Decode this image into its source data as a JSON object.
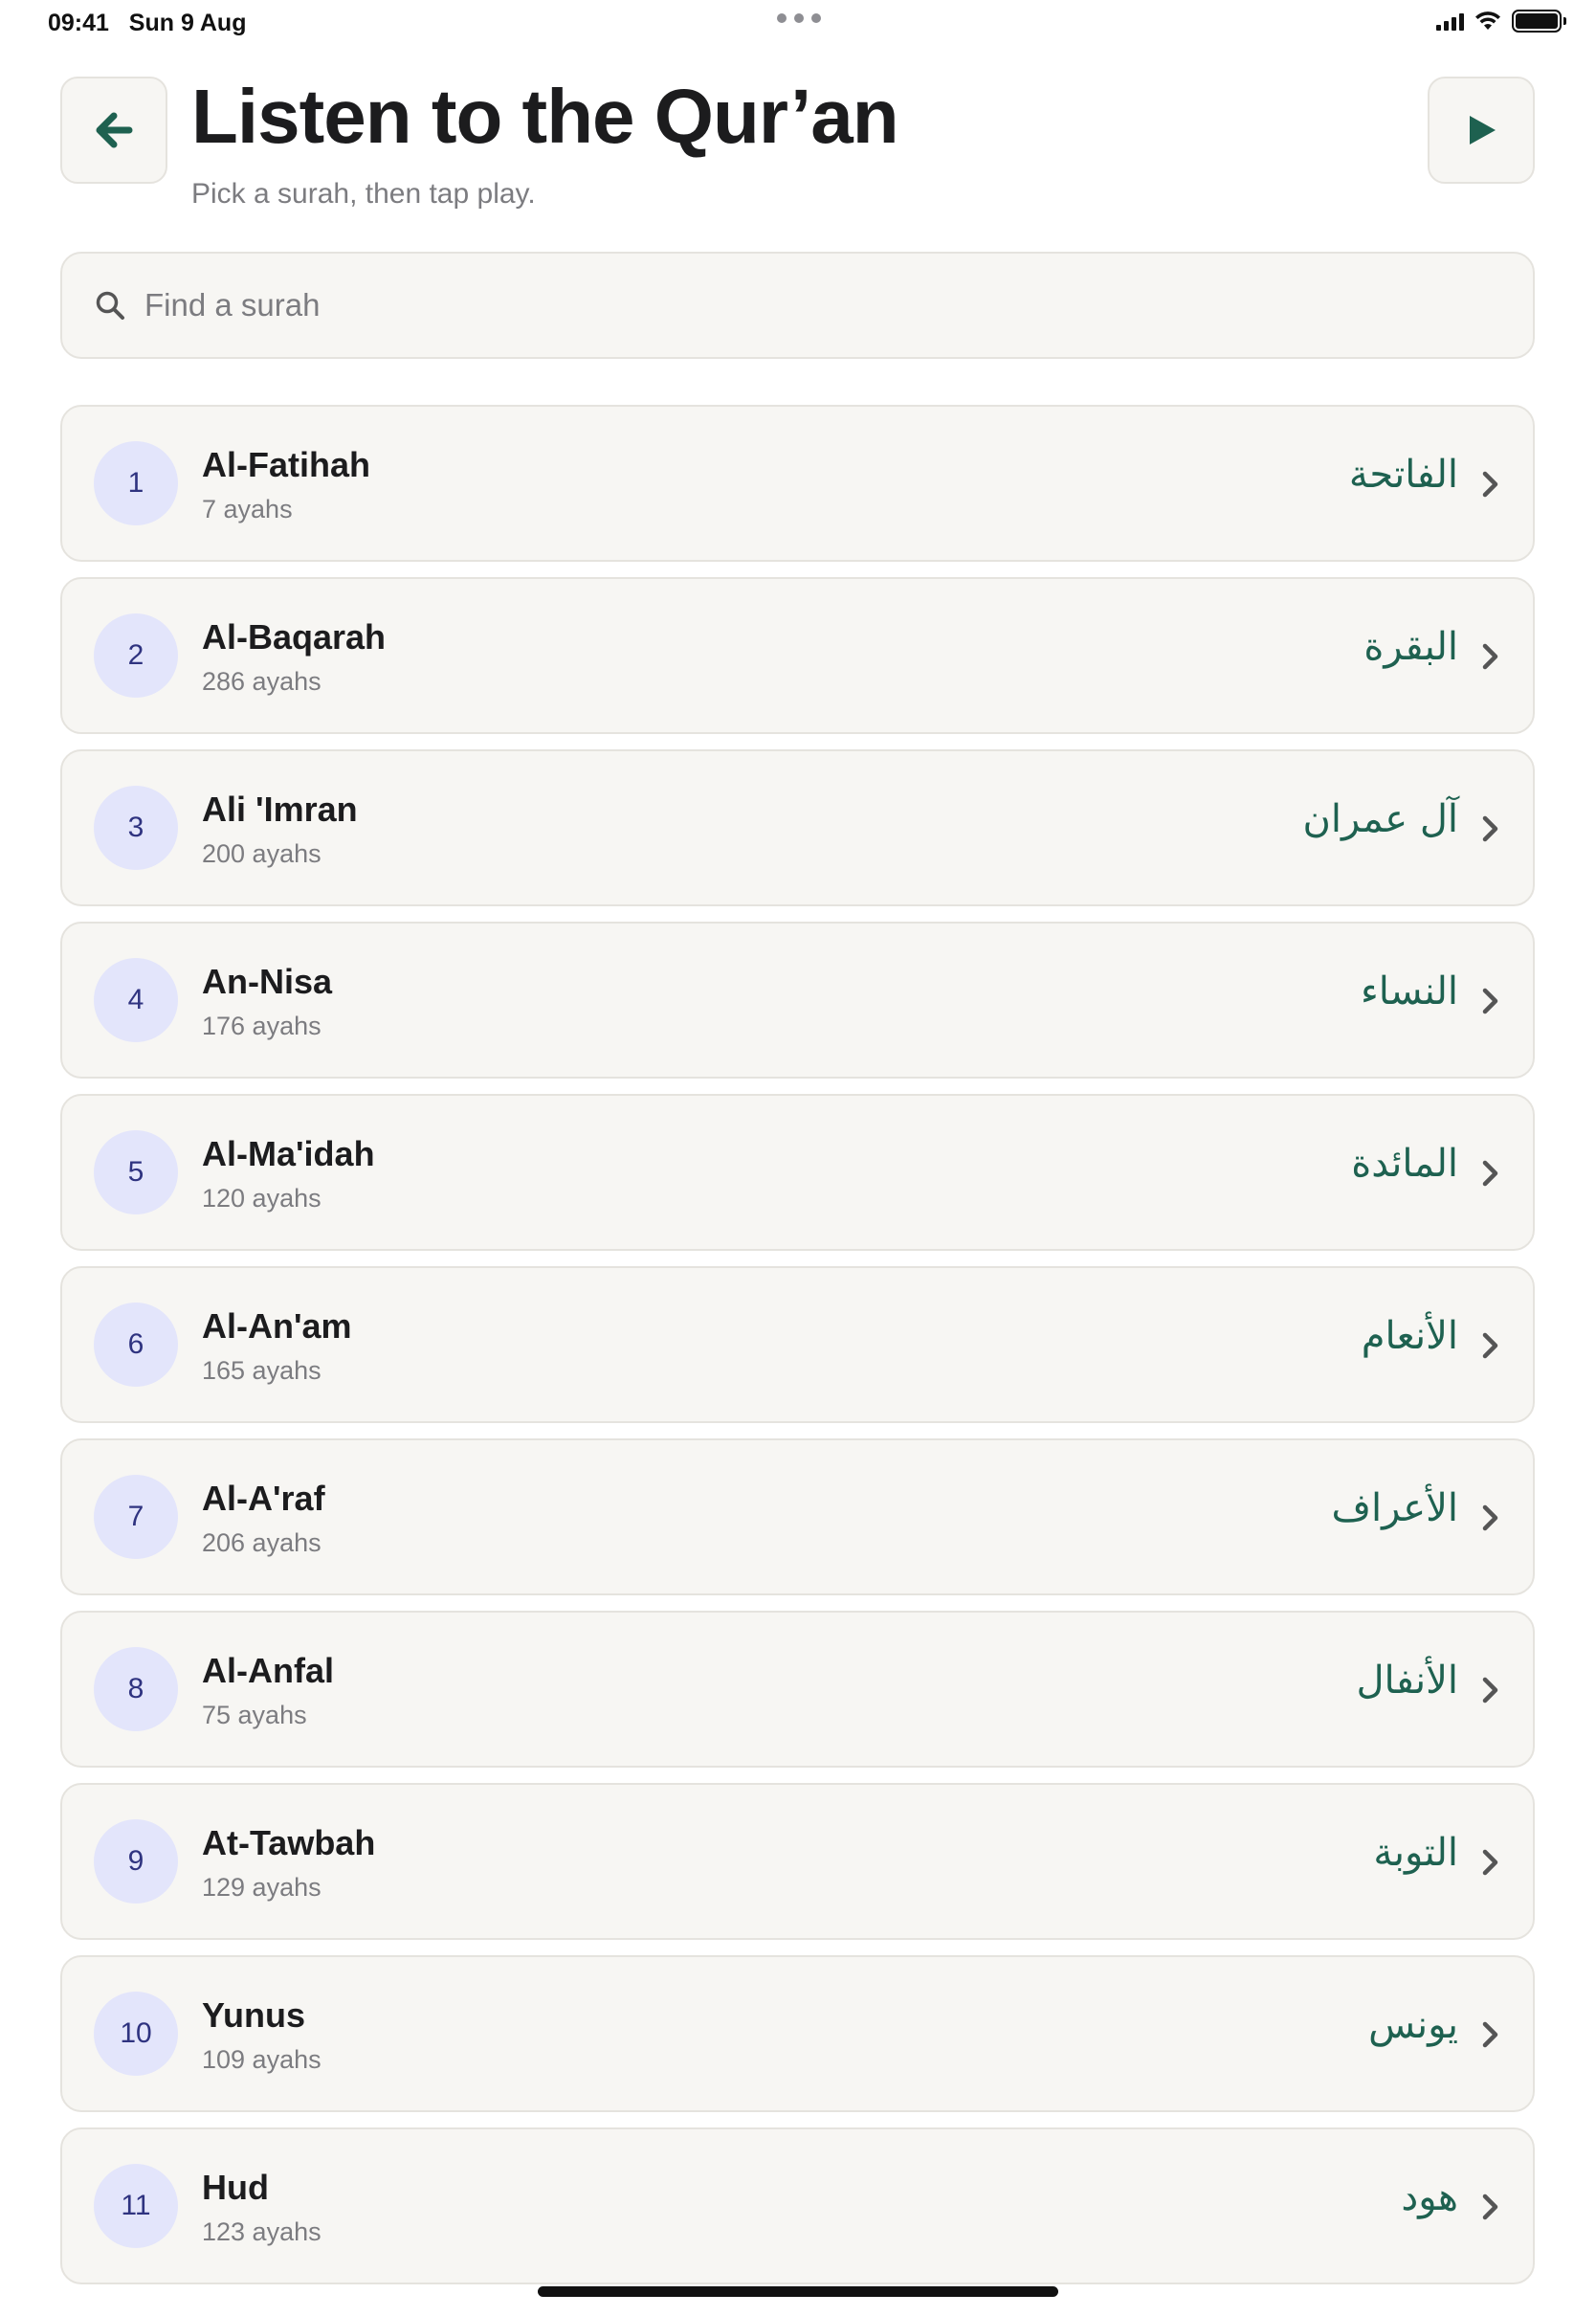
{
  "status_bar": {
    "time": "09:41",
    "date": "Sun 9 Aug"
  },
  "header": {
    "back_icon": "arrow-left-icon",
    "title": "Listen to the Qur’an",
    "subtitle": "Pick a surah, then tap play.",
    "play_icon": "play-icon"
  },
  "search": {
    "placeholder": "Find a surah",
    "value": ""
  },
  "colors": {
    "accent": "#1e6150",
    "badge_bg": "#e3e5fb",
    "badge_text": "#2f3380",
    "card_bg": "#f7f6f3"
  },
  "surahs": [
    {
      "number": "1",
      "name": "Al-Fatihah",
      "ayahs": "7 ayahs",
      "arabic": "الفاتحة"
    },
    {
      "number": "2",
      "name": "Al-Baqarah",
      "ayahs": "286 ayahs",
      "arabic": "البقرة"
    },
    {
      "number": "3",
      "name": "Ali 'Imran",
      "ayahs": "200 ayahs",
      "arabic": "آل عمران"
    },
    {
      "number": "4",
      "name": "An-Nisa",
      "ayahs": "176 ayahs",
      "arabic": "النساء"
    },
    {
      "number": "5",
      "name": "Al-Ma'idah",
      "ayahs": "120 ayahs",
      "arabic": "المائدة"
    },
    {
      "number": "6",
      "name": "Al-An'am",
      "ayahs": "165 ayahs",
      "arabic": "الأنعام"
    },
    {
      "number": "7",
      "name": "Al-A'raf",
      "ayahs": "206 ayahs",
      "arabic": "الأعراف"
    },
    {
      "number": "8",
      "name": "Al-Anfal",
      "ayahs": "75 ayahs",
      "arabic": "الأنفال"
    },
    {
      "number": "9",
      "name": "At-Tawbah",
      "ayahs": "129 ayahs",
      "arabic": "التوبة"
    },
    {
      "number": "10",
      "name": "Yunus",
      "ayahs": "109 ayahs",
      "arabic": "يونس"
    },
    {
      "number": "11",
      "name": "Hud",
      "ayahs": "123 ayahs",
      "arabic": "هود"
    }
  ]
}
